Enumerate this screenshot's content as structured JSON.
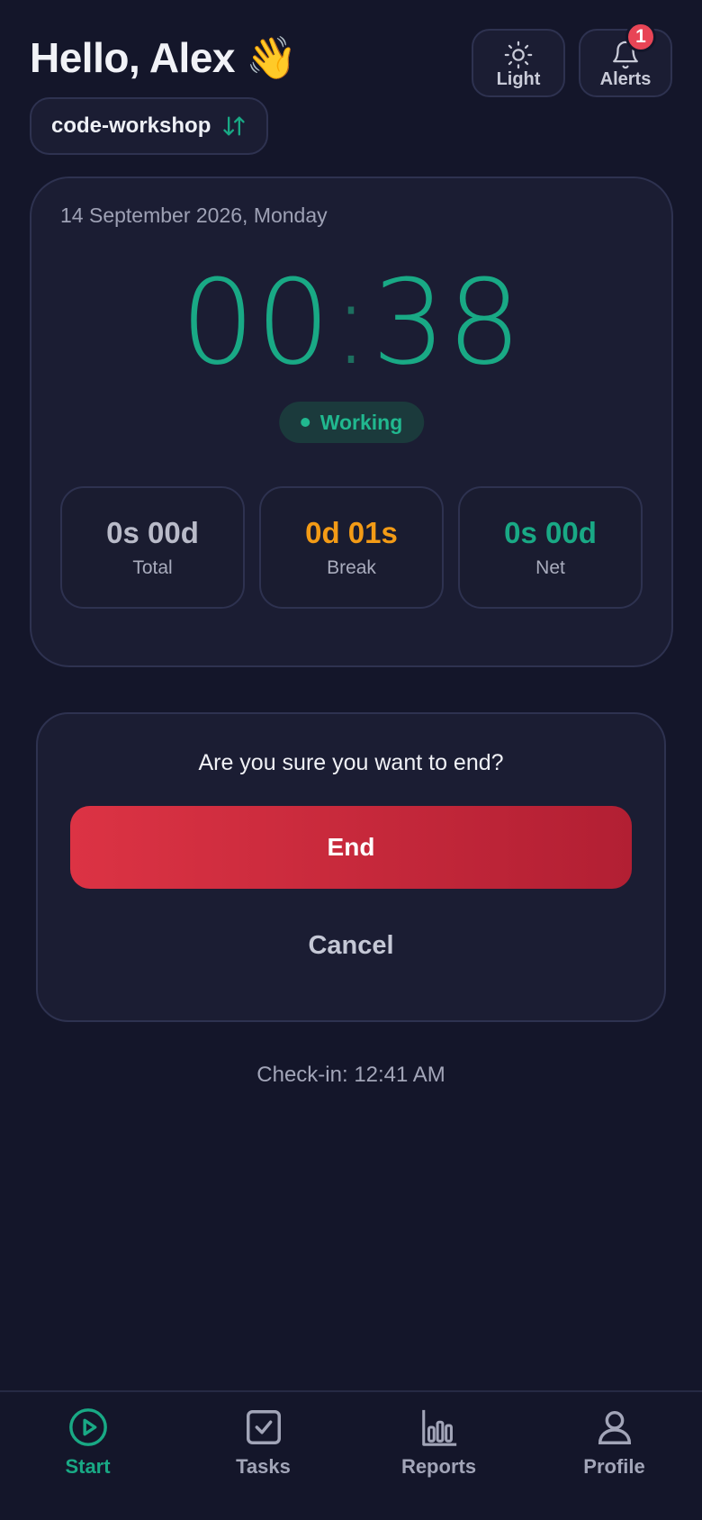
{
  "header": {
    "greeting": "Hello, Alex 👋",
    "light_label": "Light",
    "alerts_label": "Alerts",
    "alerts_count": "1",
    "workspace": "code-workshop"
  },
  "timer_card": {
    "date": "14 September 2026, Monday",
    "timer_left": "00",
    "timer_right": "38",
    "status": "Working",
    "stats": [
      {
        "value": "0s 00d",
        "label": "Total",
        "color": "#b9bbc9"
      },
      {
        "value": "0d 01s",
        "label": "Break",
        "color": "#f39b16"
      },
      {
        "value": "0s 00d",
        "label": "Net",
        "color": "#19a985"
      }
    ]
  },
  "confirm": {
    "question": "Are you sure you want to end?",
    "end_label": "End",
    "cancel_label": "Cancel"
  },
  "checkin": "Check-in: 12:41 AM",
  "tabs": [
    {
      "label": "Start",
      "icon": "play-circle-icon",
      "active": true
    },
    {
      "label": "Tasks",
      "icon": "checkbox-icon",
      "active": false
    },
    {
      "label": "Reports",
      "icon": "bar-chart-icon",
      "active": false
    },
    {
      "label": "Profile",
      "icon": "user-icon",
      "active": false
    }
  ],
  "colors": {
    "accent": "#19a985",
    "danger": "#dc3344",
    "background": "#14162a"
  }
}
